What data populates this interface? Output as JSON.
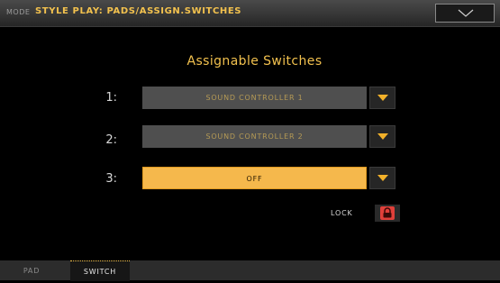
{
  "header": {
    "mode_label": "MODE",
    "title": "STYLE PLAY: PADS/ASSIGN.SWITCHES"
  },
  "main": {
    "section_title": "Assignable Switches",
    "switches": [
      {
        "label": "1:",
        "value": "SOUND CONTROLLER 1"
      },
      {
        "label": "2:",
        "value": "SOUND CONTROLLER 2"
      },
      {
        "label": "3:",
        "value": "OFF"
      }
    ],
    "lock_label": "LOCK"
  },
  "tabs": [
    {
      "label": "PAD"
    },
    {
      "label": "SWITCH"
    }
  ],
  "colors": {
    "accent": "#f2c14e",
    "selected_field": "#f5b84c",
    "lock": "#e0403a"
  }
}
